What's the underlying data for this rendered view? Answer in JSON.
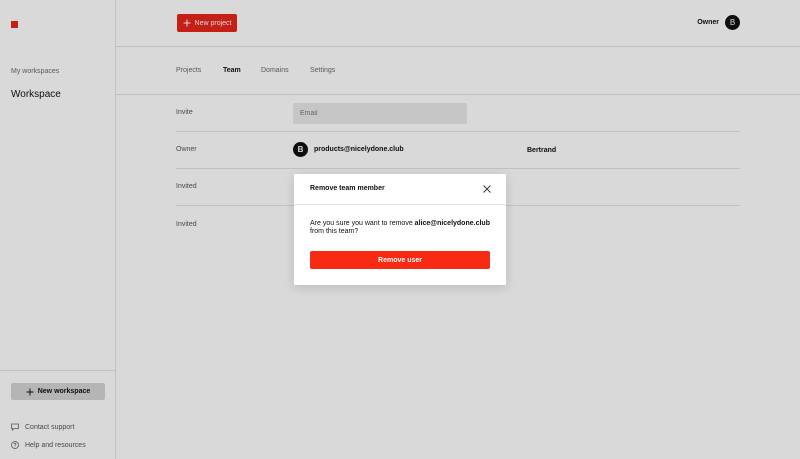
{
  "sidebar": {
    "workspaces_label": "My workspaces",
    "workspace_name": "Workspace",
    "new_workspace_label": "New workspace",
    "contact_support_label": "Contact support",
    "help_label": "Help and resources"
  },
  "header": {
    "new_project_label": "New project",
    "role_label": "Owner",
    "avatar_initial": "B"
  },
  "tabs": [
    {
      "label": "Projects"
    },
    {
      "label": "Team"
    },
    {
      "label": "Domains"
    },
    {
      "label": "Settings"
    }
  ],
  "team": {
    "invite_label": "Invite",
    "email_placeholder": "Email",
    "rows": [
      {
        "role": "Owner",
        "avatar_initial": "B",
        "email": "products@nicelydone.club",
        "name": "Bertrand"
      },
      {
        "role": "Invited"
      },
      {
        "role": "Invited"
      }
    ]
  },
  "modal": {
    "title": "Remove team member",
    "message_prefix": "Are you sure you want to remove ",
    "email": "alice@nicelydone.club",
    "message_suffix": "from this team?",
    "confirm_label": "Remove user"
  },
  "colors": {
    "brand": "#e8261a",
    "danger": "#f72a14"
  }
}
